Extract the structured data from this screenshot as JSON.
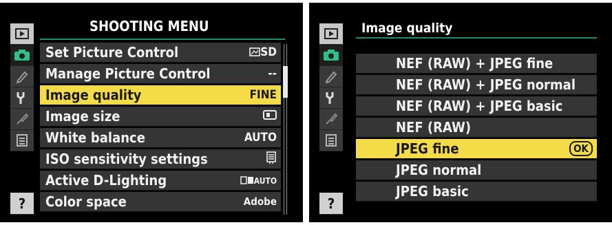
{
  "left_screen": {
    "title": "SHOOTING MENU",
    "tabs": [
      "playback-menu",
      "shooting-menu",
      "custom-settings",
      "setup-menu",
      "retouch-menu",
      "my-menu",
      "help"
    ],
    "help_label": "?",
    "items": [
      {
        "label": "Set Picture Control",
        "value": "SD"
      },
      {
        "label": "Manage Picture Control",
        "value": "--"
      },
      {
        "label": "Image quality",
        "value": "FINE"
      },
      {
        "label": "Image size",
        "value": ""
      },
      {
        "label": "White balance",
        "value": "AUTO"
      },
      {
        "label": "ISO sensitivity settings",
        "value": ""
      },
      {
        "label": "Active D-Lighting",
        "value": "AUTO"
      },
      {
        "label": "Color space",
        "value": "Adobe"
      }
    ],
    "selected_index": 2
  },
  "right_screen": {
    "title": "Image quality",
    "help_label": "?",
    "options": [
      {
        "label": "NEF (RAW) + JPEG fine"
      },
      {
        "label": "NEF (RAW) + JPEG normal"
      },
      {
        "label": "NEF (RAW) + JPEG basic"
      },
      {
        "label": "NEF (RAW)"
      },
      {
        "label": "JPEG fine"
      },
      {
        "label": "JPEG normal"
      },
      {
        "label": "JPEG basic"
      }
    ],
    "selected_index": 4,
    "ok_label": "OK"
  },
  "colors": {
    "highlight": "#f3dc48",
    "row_bg": "#353535",
    "title_rule": "#1f8f6a",
    "camera_tab": "#2fc08a"
  }
}
